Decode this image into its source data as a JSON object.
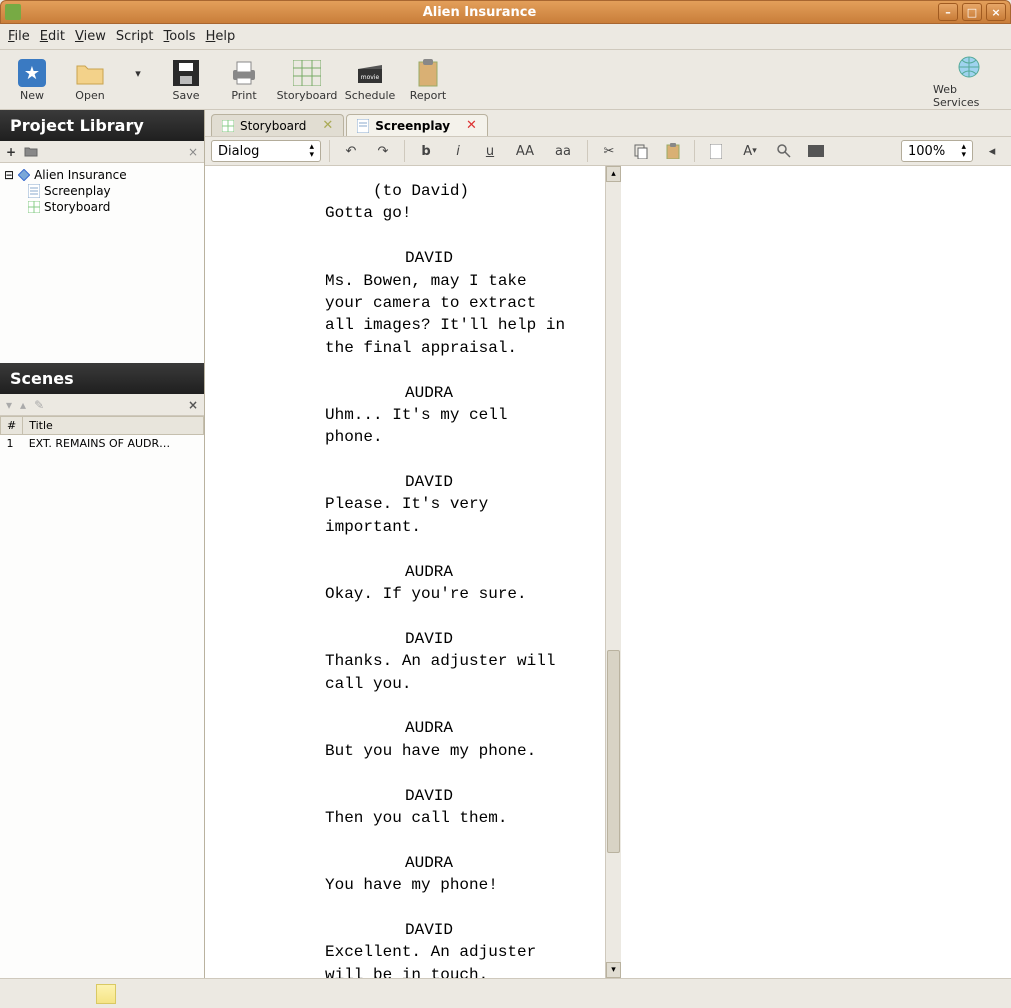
{
  "window": {
    "title": "Alien Insurance"
  },
  "menu": {
    "file": "File",
    "edit": "Edit",
    "view": "View",
    "script": "Script",
    "tools": "Tools",
    "help": "Help"
  },
  "toolbar": {
    "new": "New",
    "open": "Open",
    "save": "Save",
    "print": "Print",
    "storyboard": "Storyboard",
    "schedule": "Schedule",
    "report": "Report",
    "web": "Web Services"
  },
  "panels": {
    "library": "Project Library",
    "scenes": "Scenes"
  },
  "tree": {
    "project": "Alien Insurance",
    "screenplay": "Screenplay",
    "storyboard": "Storyboard"
  },
  "scene_table": {
    "col_num": "#",
    "col_title": "Title",
    "rows": [
      {
        "num": "1",
        "title": "EXT. REMAINS OF AUDR…"
      }
    ]
  },
  "tabs": {
    "storyboard": "Storyboard",
    "screenplay": "Screenplay"
  },
  "editbar": {
    "style": "Dialog",
    "zoom": "100%"
  },
  "script": [
    {
      "t": "paren",
      "v": "(to David)"
    },
    {
      "t": "dialog",
      "v": "Gotta go!"
    },
    {
      "t": "blank",
      "v": ""
    },
    {
      "t": "character",
      "v": "DAVID"
    },
    {
      "t": "dialog",
      "v": "Ms. Bowen, may I take"
    },
    {
      "t": "dialog",
      "v": "your camera to extract"
    },
    {
      "t": "dialog",
      "v": "all images? It'll help in"
    },
    {
      "t": "dialog",
      "v": "the final appraisal."
    },
    {
      "t": "blank",
      "v": ""
    },
    {
      "t": "character",
      "v": "AUDRA"
    },
    {
      "t": "dialog",
      "v": "Uhm... It's my cell"
    },
    {
      "t": "dialog",
      "v": "phone."
    },
    {
      "t": "blank",
      "v": ""
    },
    {
      "t": "character",
      "v": "DAVID"
    },
    {
      "t": "dialog",
      "v": "Please. It's very"
    },
    {
      "t": "dialog",
      "v": "important."
    },
    {
      "t": "blank",
      "v": ""
    },
    {
      "t": "character",
      "v": "AUDRA"
    },
    {
      "t": "dialog",
      "v": "Okay. If you're sure."
    },
    {
      "t": "blank",
      "v": ""
    },
    {
      "t": "character",
      "v": "DAVID"
    },
    {
      "t": "dialog",
      "v": "Thanks. An adjuster will"
    },
    {
      "t": "dialog",
      "v": "call you."
    },
    {
      "t": "blank",
      "v": ""
    },
    {
      "t": "character",
      "v": "AUDRA"
    },
    {
      "t": "dialog",
      "v": "But you have my phone."
    },
    {
      "t": "blank",
      "v": ""
    },
    {
      "t": "character",
      "v": "DAVID"
    },
    {
      "t": "dialog",
      "v": "Then you call them."
    },
    {
      "t": "blank",
      "v": ""
    },
    {
      "t": "character",
      "v": "AUDRA"
    },
    {
      "t": "dialog",
      "v": "You have my phone!"
    },
    {
      "t": "blank",
      "v": ""
    },
    {
      "t": "character",
      "v": "DAVID"
    },
    {
      "t": "dialog",
      "v": "Excellent. An adjuster"
    },
    {
      "t": "dialog",
      "v": "will be in touch."
    }
  ]
}
